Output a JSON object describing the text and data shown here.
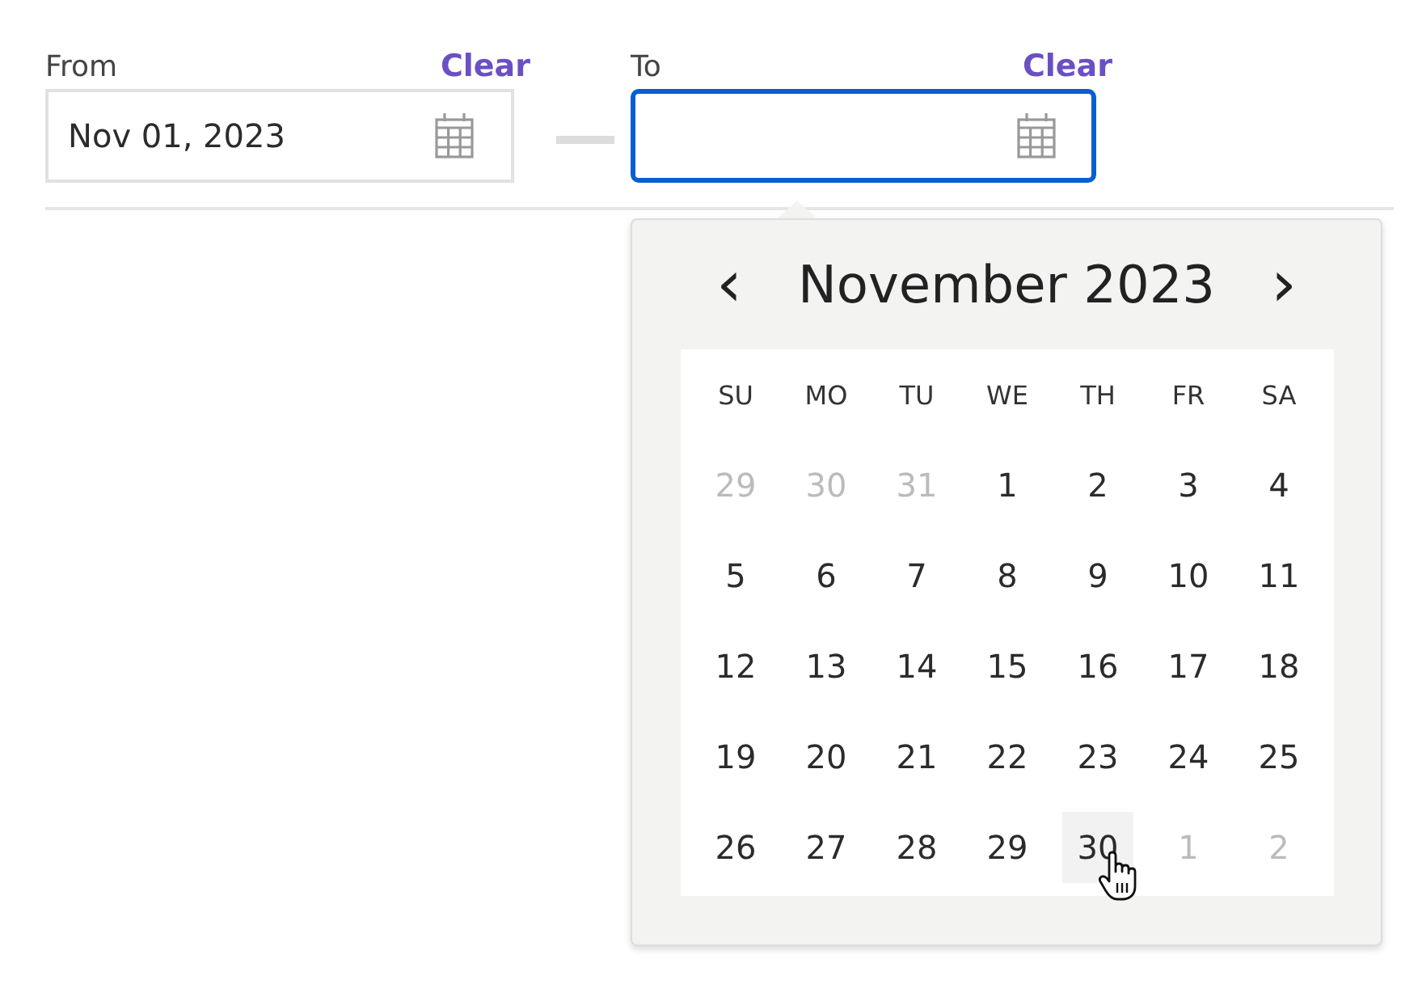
{
  "fields": [
    {
      "label": "From",
      "clear": "Clear",
      "value": "Nov 01, 2023",
      "focused": false
    },
    {
      "label": "To",
      "clear": "Clear",
      "focused": true
    }
  ],
  "calendar": {
    "prev": "‹",
    "title": "November 2023",
    "next": "›",
    "weekdays": [
      "SU",
      "MO",
      "TU",
      "WE",
      "TH",
      "FR",
      "SA"
    ],
    "days": [
      {
        "label": "29",
        "outside": true,
        "hovered": false
      },
      {
        "label": "30",
        "outside": true,
        "hovered": false
      },
      {
        "label": "31",
        "outside": true,
        "hovered": false
      },
      {
        "label": "1",
        "outside": false,
        "hovered": false
      },
      {
        "label": "2",
        "outside": false,
        "hovered": false
      },
      {
        "label": "3",
        "outside": false,
        "hovered": false
      },
      {
        "label": "4",
        "outside": false,
        "hovered": false
      },
      {
        "label": "5",
        "outside": false,
        "hovered": false
      },
      {
        "label": "6",
        "outside": false,
        "hovered": false
      },
      {
        "label": "7",
        "outside": false,
        "hovered": false
      },
      {
        "label": "8",
        "outside": false,
        "hovered": false
      },
      {
        "label": "9",
        "outside": false,
        "hovered": false
      },
      {
        "label": "10",
        "outside": false,
        "hovered": false
      },
      {
        "label": "11",
        "outside": false,
        "hovered": false
      },
      {
        "label": "12",
        "outside": false,
        "hovered": false
      },
      {
        "label": "13",
        "outside": false,
        "hovered": false
      },
      {
        "label": "14",
        "outside": false,
        "hovered": false
      },
      {
        "label": "15",
        "outside": false,
        "hovered": false
      },
      {
        "label": "16",
        "outside": false,
        "hovered": false
      },
      {
        "label": "17",
        "outside": false,
        "hovered": false
      },
      {
        "label": "18",
        "outside": false,
        "hovered": false
      },
      {
        "label": "19",
        "outside": false,
        "hovered": false
      },
      {
        "label": "20",
        "outside": false,
        "hovered": false
      },
      {
        "label": "21",
        "outside": false,
        "hovered": false
      },
      {
        "label": "22",
        "outside": false,
        "hovered": false
      },
      {
        "label": "23",
        "outside": false,
        "hovered": false
      },
      {
        "label": "24",
        "outside": false,
        "hovered": false
      },
      {
        "label": "25",
        "outside": false,
        "hovered": false
      },
      {
        "label": "26",
        "outside": false,
        "hovered": false
      },
      {
        "label": "27",
        "outside": false,
        "hovered": false
      },
      {
        "label": "28",
        "outside": false,
        "hovered": false
      },
      {
        "label": "29",
        "outside": false,
        "hovered": false
      },
      {
        "label": "30",
        "outside": false,
        "hovered": true
      },
      {
        "label": "1",
        "outside": true,
        "hovered": false
      },
      {
        "label": "2",
        "outside": true,
        "hovered": false
      }
    ]
  }
}
